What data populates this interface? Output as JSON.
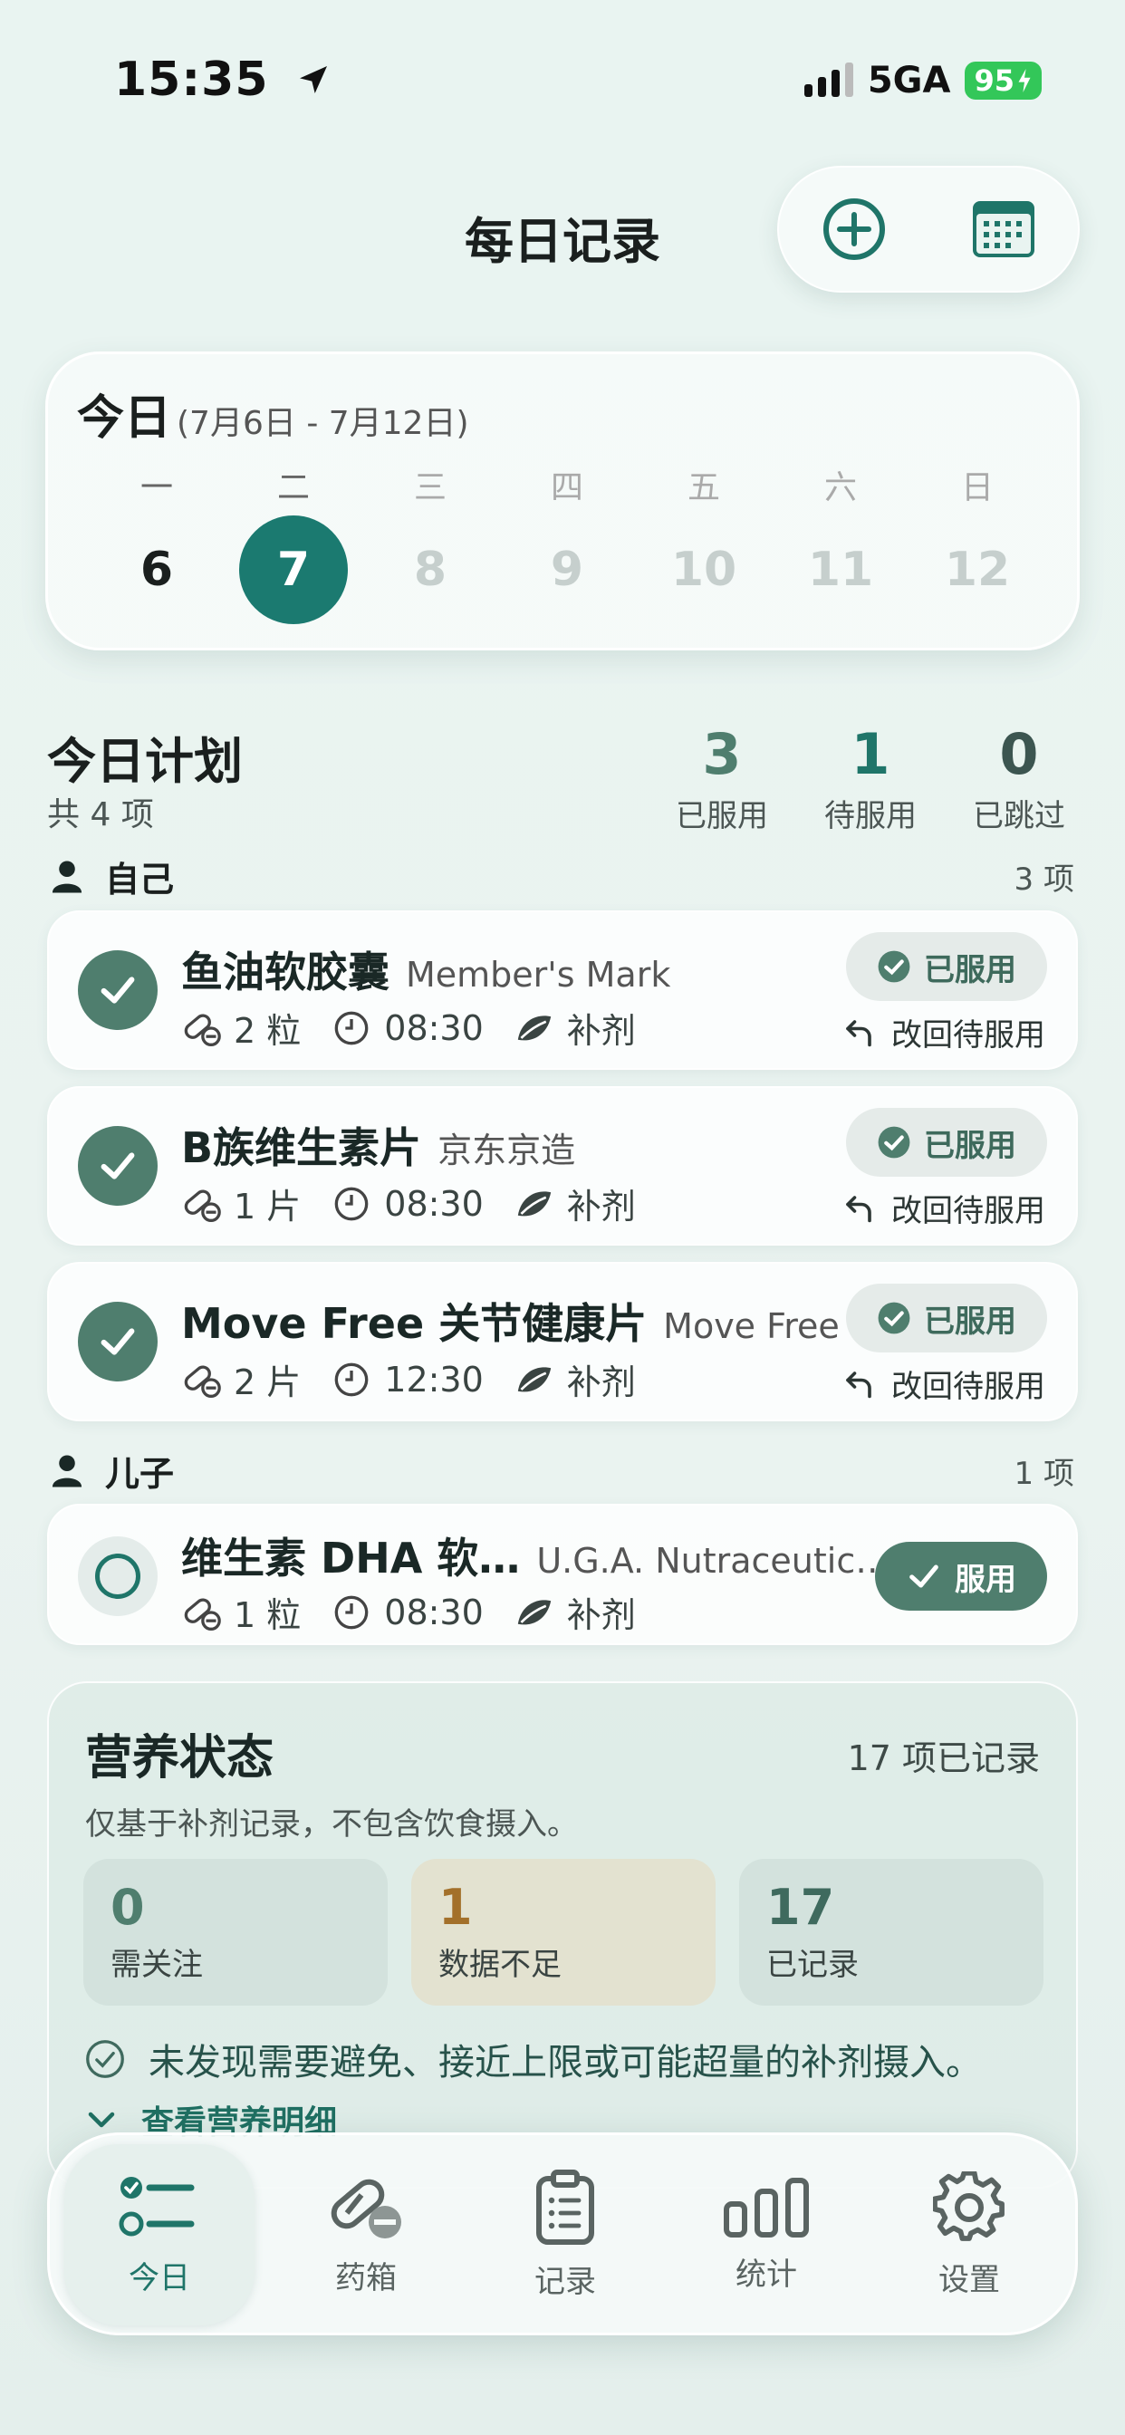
{
  "status": {
    "time": "15:35",
    "network": "5GA",
    "battery": "95"
  },
  "header": {
    "title": "每日记录"
  },
  "week": {
    "title": "今日",
    "range": "(7月6日 - 7月12日)",
    "weekdays": [
      "一",
      "二",
      "三",
      "四",
      "五",
      "六",
      "日"
    ],
    "dates": [
      "6",
      "7",
      "8",
      "9",
      "10",
      "11",
      "12"
    ],
    "selected_index": 1
  },
  "plan": {
    "title": "今日计划",
    "subtitle": "共 4 项",
    "stats": [
      {
        "value": "3",
        "label": "已服用",
        "color": "#4f7e6e"
      },
      {
        "value": "1",
        "label": "待服用",
        "color": "#1f7569"
      },
      {
        "value": "0",
        "label": "已跳过",
        "color": "#3c5550"
      }
    ]
  },
  "groups": [
    {
      "name": "自己",
      "count": "3 项",
      "items": [
        {
          "name": "鱼油软胶囊",
          "brand": "Member's Mark",
          "dose": "2 粒",
          "time": "08:30",
          "category": "补剂",
          "status_label": "已服用",
          "revert_label": "改回待服用"
        },
        {
          "name": "B族维生素片",
          "brand": "京东京造",
          "dose": "1 片",
          "time": "08:30",
          "category": "补剂",
          "status_label": "已服用",
          "revert_label": "改回待服用"
        },
        {
          "name": "Move Free 关节健康片",
          "brand": "Move Free",
          "dose": "2 片",
          "time": "12:30",
          "category": "补剂",
          "status_label": "已服用",
          "revert_label": "改回待服用"
        }
      ]
    },
    {
      "name": "儿子",
      "count": "1 项",
      "items": [
        {
          "name": "维生素 DHA 软…",
          "brand": "U.G.A. Nutraceutic…",
          "dose": "1 粒",
          "time": "08:30",
          "category": "补剂",
          "action_label": "服用"
        }
      ]
    }
  ],
  "nutrition": {
    "title": "营养状态",
    "count": "17 项已记录",
    "description": "仅基于补剂记录，不包含饮食摄入。",
    "boxes": [
      {
        "value": "0",
        "label": "需关注",
        "bg": "#d3e2dd",
        "color": "#4f7e6e"
      },
      {
        "value": "1",
        "label": "数据不足",
        "bg": "#e3e2d0",
        "color": "#a3702a"
      },
      {
        "value": "17",
        "label": "已记录",
        "bg": "#d3e2dd",
        "color": "#3f6a5e"
      }
    ],
    "ok_text": "未发现需要避免、接近上限或可能超量的补剂摄入。",
    "more_text": "查看营养明细"
  },
  "tabs": [
    {
      "label": "今日",
      "icon": "checklist-icon",
      "active": true
    },
    {
      "label": "药箱",
      "icon": "pill-icon"
    },
    {
      "label": "记录",
      "icon": "clipboard-icon"
    },
    {
      "label": "统计",
      "icon": "bar-stats-icon"
    },
    {
      "label": "设置",
      "icon": "gear-icon"
    }
  ],
  "colors": {
    "accent": "#1b7a70",
    "taken": "#4f7e6e"
  }
}
